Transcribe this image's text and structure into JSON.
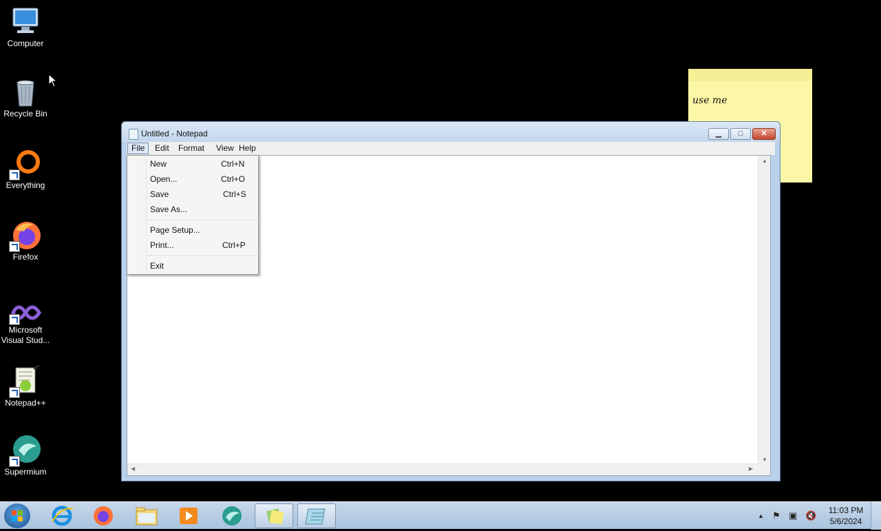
{
  "desktop": {
    "icons": [
      {
        "label": "Computer"
      },
      {
        "label": "Recycle Bin"
      },
      {
        "label": "Everything"
      },
      {
        "label": "Firefox"
      },
      {
        "label": "Microsoft\nVisual Stud..."
      },
      {
        "label": "Notepad++"
      },
      {
        "label": "Supermium"
      }
    ]
  },
  "sticky_note": {
    "text": "use me"
  },
  "notepad": {
    "title": "Untitled - Notepad",
    "menus": [
      "File",
      "Edit",
      "Format",
      "View",
      "Help"
    ],
    "file_menu": [
      {
        "label": "New",
        "shortcut": "Ctrl+N"
      },
      {
        "label": "Open...",
        "shortcut": "Ctrl+O"
      },
      {
        "label": "Save",
        "shortcut": "Ctrl+S"
      },
      {
        "label": "Save As...",
        "shortcut": ""
      },
      {
        "label": "Page Setup...",
        "shortcut": ""
      },
      {
        "label": "Print...",
        "shortcut": "Ctrl+P"
      },
      {
        "label": "Exit",
        "shortcut": ""
      }
    ],
    "content": ""
  },
  "taskbar": {
    "pinned": [
      "internet-explorer-icon",
      "firefox-icon",
      "file-explorer-icon",
      "media-player-icon",
      "supermium-icon",
      "sticky-notes-icon",
      "notepad-icon"
    ],
    "clock": {
      "time": "11:03 PM",
      "date": "5/6/2024"
    }
  }
}
